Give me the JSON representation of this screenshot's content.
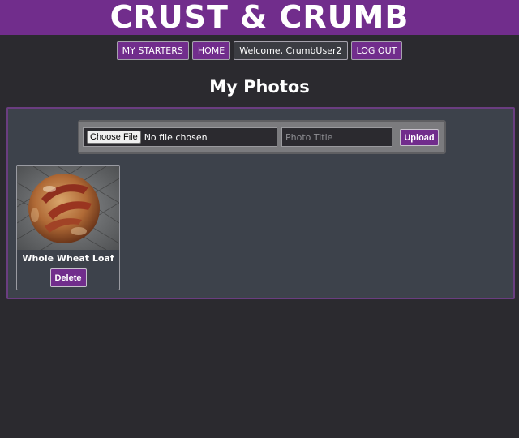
{
  "header": {
    "brand": "CRUST & CRUMB"
  },
  "nav": {
    "my_starters": "MY STARTERS",
    "home": "HOME",
    "welcome": "Welcome, CrumbUser2",
    "log_out": "LOG OUT"
  },
  "page": {
    "title": "My Photos"
  },
  "upload": {
    "choose_file_label": "Choose File",
    "no_file_text": "No file chosen",
    "title_placeholder": "Photo Title",
    "title_value": "",
    "upload_label": "Upload"
  },
  "photos": [
    {
      "title": "Whole Wheat Loaf",
      "delete_label": "Delete",
      "image_icon": "bread-loaf-photo"
    }
  ],
  "colors": {
    "brand_purple": "#712d8c",
    "background": "#2b2a2f",
    "panel": "#3d424b"
  }
}
